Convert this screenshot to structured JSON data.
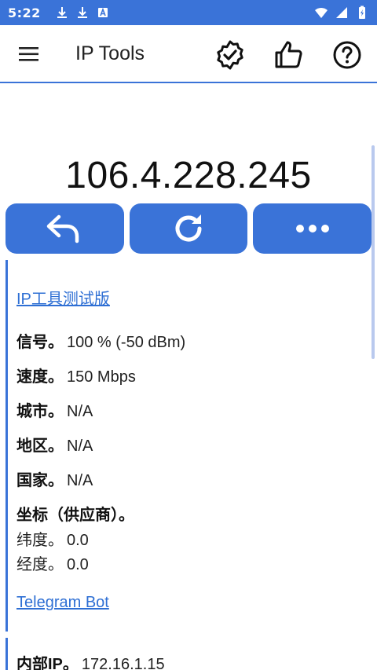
{
  "status_bar": {
    "time": "5:22",
    "left_icons": [
      "download-icon",
      "download-icon",
      "app-notification-icon"
    ],
    "right_icons": [
      "wifi-icon",
      "signal-icon",
      "battery-icon"
    ]
  },
  "app_bar": {
    "title": "IP Tools",
    "actions": [
      "verified-badge-icon",
      "thumbs-up-icon",
      "help-icon"
    ]
  },
  "ip": {
    "address": "106.4.228.245"
  },
  "actions": [
    "back-arrow-icon",
    "refresh-icon",
    "more-dots-icon"
  ],
  "info": {
    "app_link": "IP工具测试版",
    "signal_label": "信号。",
    "signal_value": "100 % (-50 dBm)",
    "speed_label": "速度。",
    "speed_value": "150 Mbps",
    "city_label": "城市。",
    "city_value": "N/A",
    "region_label": "地区。",
    "region_value": "N/A",
    "country_label": "国家。",
    "country_value": "N/A",
    "coords_label": "坐标（供应商）。",
    "lat_label": "纬度。",
    "lat_value": "0.0",
    "lon_label": "经度。",
    "lon_value": "0.0",
    "telegram_link": "Telegram Bot",
    "internal_ip_label": "内部IP。",
    "internal_ip_value": "172.16.1.15"
  },
  "colors": {
    "primary": "#3a73d8",
    "link": "#2e6fd4"
  }
}
